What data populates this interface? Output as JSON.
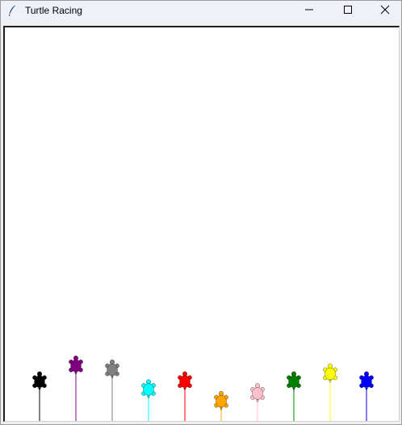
{
  "window": {
    "title": "Turtle Racing",
    "app_icon": "feather-icon",
    "controls": {
      "minimize_icon": "minimize-icon",
      "maximize_icon": "maximize-icon",
      "close_icon": "close-icon"
    }
  },
  "racers": [
    {
      "color": "black",
      "hex": "#000000",
      "progress": 0.1
    },
    {
      "color": "purple",
      "hex": "#800080",
      "progress": 0.14
    },
    {
      "color": "gray",
      "hex": "#808080",
      "progress": 0.13
    },
    {
      "color": "cyan",
      "hex": "#00ffff",
      "progress": 0.08
    },
    {
      "color": "red",
      "hex": "#ff0000",
      "progress": 0.1
    },
    {
      "color": "orange",
      "hex": "#ffa500",
      "progress": 0.05
    },
    {
      "color": "pink",
      "hex": "#ffc0cb",
      "progress": 0.07
    },
    {
      "color": "green",
      "hex": "#008000",
      "progress": 0.1
    },
    {
      "color": "yellow",
      "hex": "#ffff00",
      "progress": 0.12
    },
    {
      "color": "blue",
      "hex": "#0000ff",
      "progress": 0.1
    }
  ]
}
